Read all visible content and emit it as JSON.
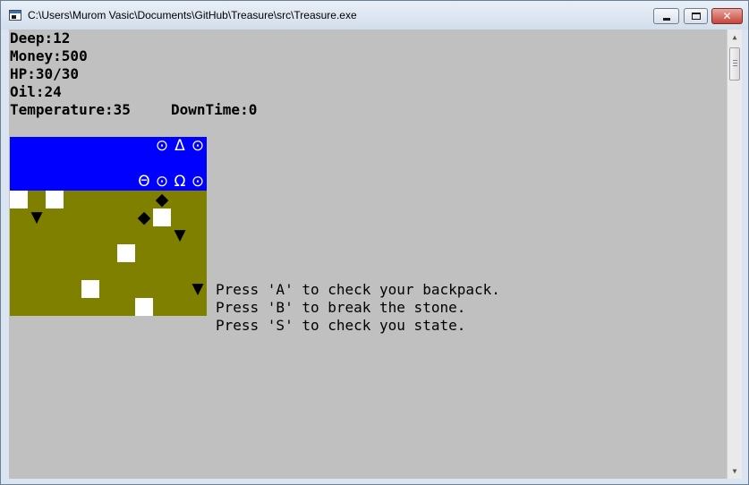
{
  "window": {
    "title": "C:\\Users\\Murom Vasic\\Documents\\GitHub\\Treasure\\src\\Treasure.exe",
    "close_glyph": "✕"
  },
  "stats": {
    "deep": "Deep:12",
    "money": "Money:500",
    "hp": "HP:30/30",
    "oil": "Oil:24",
    "temperature": "Temperature:35",
    "downtime": "DownTime:0"
  },
  "map": {
    "sky_color": "#0000ff",
    "ground_color": "#808000",
    "sky_symbols": [
      {
        "glyph": "⊙",
        "name": "sky-symbol-circle-dot"
      },
      {
        "glyph": "Δ",
        "name": "sky-symbol-delta"
      },
      {
        "glyph": "⊙",
        "name": "sky-symbol-circle-dot"
      },
      {
        "glyph": "Θ",
        "name": "sky-symbol-theta"
      },
      {
        "glyph": "⊙",
        "name": "sky-symbol-circle-dot"
      },
      {
        "glyph": "Ω",
        "name": "sky-symbol-omega"
      },
      {
        "glyph": "⊙",
        "name": "sky-symbol-circle-dot"
      }
    ],
    "gem_glyph": "◆",
    "spike_glyph": "▼"
  },
  "help": {
    "line_a": "Press 'A' to check your backpack.",
    "line_b": "Press 'B' to break the stone.",
    "line_s": "Press 'S' to check you state."
  },
  "scrollbar": {
    "up_glyph": "▲",
    "down_glyph": "▼"
  }
}
